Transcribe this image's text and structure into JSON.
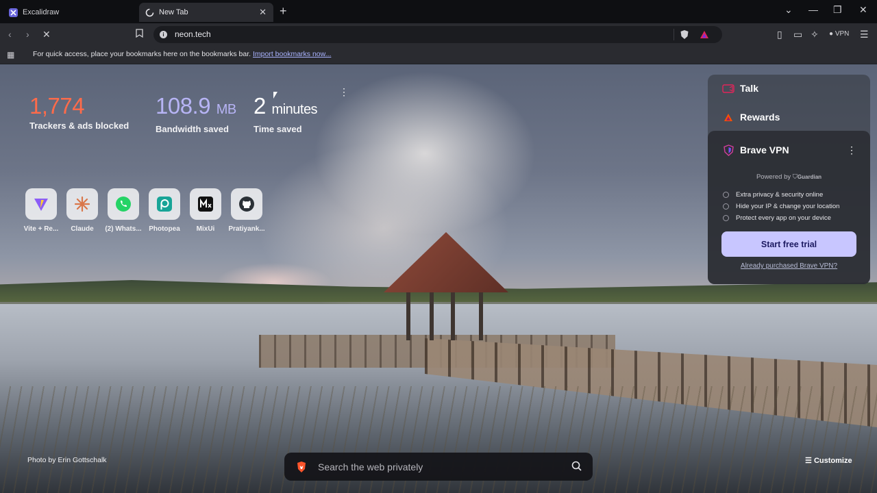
{
  "browser": {
    "tabs": [
      {
        "title": "Excalidraw",
        "icon": "excalidraw-icon",
        "active": false
      },
      {
        "title": "New Tab",
        "icon": "loading-spinner-icon",
        "active": true
      }
    ],
    "url": "neon.tech",
    "vpn_label": "VPN",
    "bookmarks_bar": {
      "message": "For quick access, place your bookmarks here on the bookmarks bar.",
      "link": "Import bookmarks now..."
    }
  },
  "stats": [
    {
      "value": "1,774",
      "unit": "",
      "label": "Trackers & ads blocked",
      "color": "#ff6b4a"
    },
    {
      "value": "108.9",
      "unit": "MB",
      "label": "Bandwidth saved",
      "color": "#b7b4f5"
    },
    {
      "value": "2",
      "unit": "minutes",
      "label": "Time saved",
      "color": "#ffffff"
    }
  ],
  "top_sites": [
    {
      "label": "Vite + Re...",
      "icon": "vite-icon"
    },
    {
      "label": "Claude",
      "icon": "claude-icon"
    },
    {
      "label": "(2) Whats...",
      "icon": "whatsapp-icon"
    },
    {
      "label": "Photopea",
      "icon": "photopea-icon"
    },
    {
      "label": "MixUi",
      "icon": "mixui-icon"
    },
    {
      "label": "Pratiyank...",
      "icon": "github-icon"
    }
  ],
  "widgets": {
    "talk": "Talk",
    "rewards": "Rewards",
    "vpn": {
      "title": "Brave VPN",
      "powered_by": "Powered by",
      "partner": "Guardian",
      "features": [
        "Extra privacy & security online",
        "Hide your IP & change your location",
        "Protect every app on your device"
      ],
      "cta": "Start free trial",
      "purchased_link": "Already purchased Brave VPN?"
    }
  },
  "photo_credit": "Photo by Erin Gottschalk",
  "search": {
    "placeholder": "Search the web privately"
  },
  "customize": "Customize",
  "colors": {
    "accent": "#c8c6ff",
    "trackers": "#ff6b4a",
    "bandwidth": "#b7b4f5"
  }
}
